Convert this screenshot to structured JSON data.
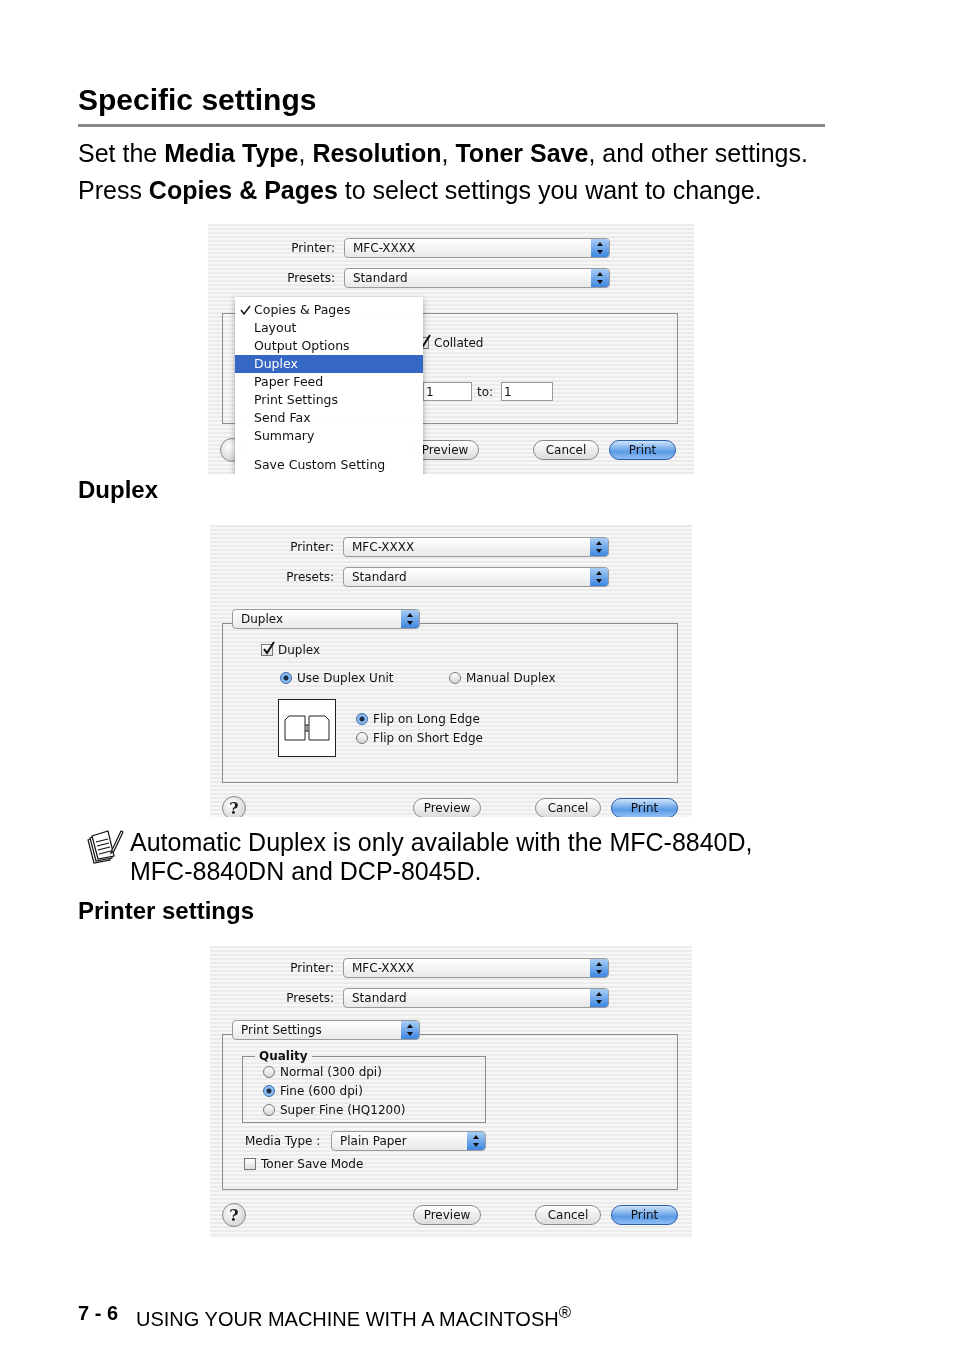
{
  "heading": "Specific settings",
  "intro": [
    "Set the **Media Type**, **Resolution**, **Toner Save**, and other settings.",
    "Press **Copies & Pages** to select settings you want to change."
  ],
  "blocks": [
    {
      "kind": "menu_open",
      "printer_label": "Printer:",
      "printer": "MFC-XXXX",
      "presets_label": "Presets:",
      "presets": "Standard",
      "collated": {
        "label": "Collated",
        "checked": true
      },
      "range": {
        "from": "1",
        "to_label": "to:",
        "to": "1"
      },
      "menu": {
        "items": [
          {
            "label": "Copies & Pages",
            "checked": true,
            "selected": false
          },
          {
            "label": "Layout",
            "checked": false,
            "selected": false
          },
          {
            "label": "Output Options",
            "checked": false,
            "selected": false
          },
          {
            "label": "Duplex",
            "checked": false,
            "selected": true
          },
          {
            "label": "Paper Feed",
            "checked": false,
            "selected": false
          },
          {
            "label": "Print Settings",
            "checked": false,
            "selected": false
          },
          {
            "label": "Send Fax",
            "checked": false,
            "selected": false
          },
          {
            "label": "Summary",
            "checked": false,
            "selected": false
          }
        ],
        "footer": "Save Custom Setting"
      },
      "buttons": [
        {
          "label": "Preview",
          "default": false
        },
        {
          "label": "Cancel",
          "default": false
        },
        {
          "label": "Print",
          "default": true
        }
      ]
    },
    {
      "kind": "subheading",
      "text": "Duplex"
    },
    {
      "kind": "duplex",
      "printer_label": "Printer:",
      "printer": "MFC-XXXX",
      "presets_label": "Presets:",
      "presets": "Standard",
      "panel": "Duplex",
      "duplex": {
        "label": "Duplex",
        "checked": true
      },
      "modes": [
        {
          "label": "Use Duplex Unit",
          "selected": true
        },
        {
          "label": "Manual Duplex",
          "selected": false
        }
      ],
      "flips": [
        {
          "label": "Flip on Long Edge",
          "selected": true
        },
        {
          "label": "Flip on Short Edge",
          "selected": false
        }
      ],
      "help": "?",
      "buttons": [
        {
          "label": "Preview",
          "default": false
        },
        {
          "label": "Cancel",
          "default": false
        },
        {
          "label": "Print",
          "default": true
        }
      ]
    },
    {
      "kind": "note",
      "text": "Automatic Duplex is only available with the MFC-8840D, MFC-8840DN and DCP-8045D."
    },
    {
      "kind": "subheading",
      "text": "Printer settings"
    },
    {
      "kind": "print_settings",
      "printer_label": "Printer:",
      "printer": "MFC-XXXX",
      "presets_label": "Presets:",
      "presets": "Standard",
      "panel": "Print Settings",
      "quality": {
        "title": "Quality",
        "options": [
          {
            "label": "Normal (300 dpi)",
            "selected": false
          },
          {
            "label": "Fine (600 dpi)",
            "selected": true
          },
          {
            "label": "Super Fine (HQ1200)",
            "selected": false
          }
        ]
      },
      "media_label": "Media Type :",
      "media": "Plain Paper",
      "toner_save": {
        "label": "Toner Save Mode",
        "checked": false
      },
      "help": "?",
      "buttons": [
        {
          "label": "Preview",
          "default": false
        },
        {
          "label": "Cancel",
          "default": false
        },
        {
          "label": "Print",
          "default": true
        }
      ]
    }
  ],
  "footer": {
    "page": "7 - 6",
    "title": "USING YOUR MACHINE WITH A MACINTOSH$^{®}$"
  }
}
